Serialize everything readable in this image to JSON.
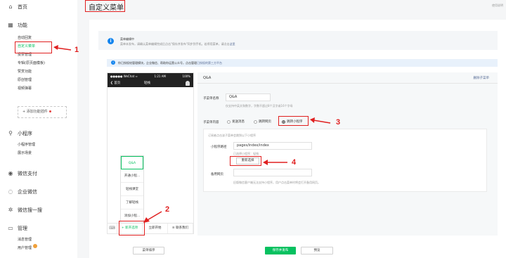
{
  "page_title": "自定义菜单",
  "top_right": "使用说明",
  "sidebar": {
    "home": {
      "icon": "home-icon",
      "label": "首页"
    },
    "function": {
      "icon": "grid-icon",
      "label": "功能",
      "items": [
        "自动回复",
        "自定义菜单",
        "投票管理",
        "专辑(原页面模板)",
        "赞赏功能",
        "原创管理",
        "视频弹幕"
      ],
      "add_plugin": "添加功能插件"
    },
    "miniprogram": {
      "icon": "link-icon",
      "label": "小程序",
      "items": [
        "小程序管理",
        "展示场景"
      ]
    },
    "pay": {
      "icon": "pay-icon",
      "label": "微信支付"
    },
    "work": {
      "icon": "work-icon",
      "label": "企业微信"
    },
    "search": {
      "icon": "sparkle-icon",
      "label": "微信搜一搜"
    },
    "manage": {
      "icon": "manage-icon",
      "label": "管理",
      "items": [
        "消息管理",
        "用户管理"
      ]
    }
  },
  "info_card": {
    "line1": "菜单编辑中",
    "line2_prefix": "菜单未发布，请确认菜单编辑完成后点击\"保存并发布\"同步到手机。若停用菜单，请点击",
    "line2_link": "这里"
  },
  "notice": {
    "text": "你已授权给管理模块，企业微信、帮助你运营公众号，点击管理",
    "link": "已授权的第三方平台"
  },
  "phone": {
    "status_left": "●●●●● WeChat ≈",
    "status_center": "1:21 AM",
    "status_right": "100%",
    "back": "❮ 首页",
    "account_name": "轻栈",
    "sub_items": [
      "Q&A",
      "开通小程...",
      "轻栈课堂",
      "了解轻栈",
      "添加小程..."
    ],
    "keyboard_icon": "⌨",
    "menus": [
      "+ 新开选项",
      "立即开始",
      "≡ 联系我们"
    ]
  },
  "editor": {
    "header_title": "Q&A",
    "delete_label": "删除子菜单",
    "name_label": "子菜单名称",
    "name_value": "Q&A",
    "name_hint": "仅支持中英文和数字，字数不超过8个汉字或16个字母",
    "content_label": "子菜单内容",
    "radios": [
      "发送消息",
      "跳转网页",
      "跳转小程序"
    ],
    "panel_hint": "订阅者点击该子菜单会跳到以下小程序",
    "path_label": "小程序路径",
    "path_value": "pages/index/index",
    "selected_hint": "已选择小程序：轻栈",
    "reselect_label": "重新选择",
    "backup_label": "备用网页",
    "backup_hint": "旧版微信客户端无法支持小程序，用户点击菜单时将会打开备用网页。"
  },
  "buttons": {
    "sort": "菜单排序",
    "save_publish": "保存并发布",
    "preview": "预览"
  },
  "annotations": [
    "1",
    "2",
    "3",
    "4"
  ],
  "colors": {
    "accent": "#07c160",
    "link": "#576b95",
    "annotation": "#e02020",
    "info": "#1485ee"
  }
}
